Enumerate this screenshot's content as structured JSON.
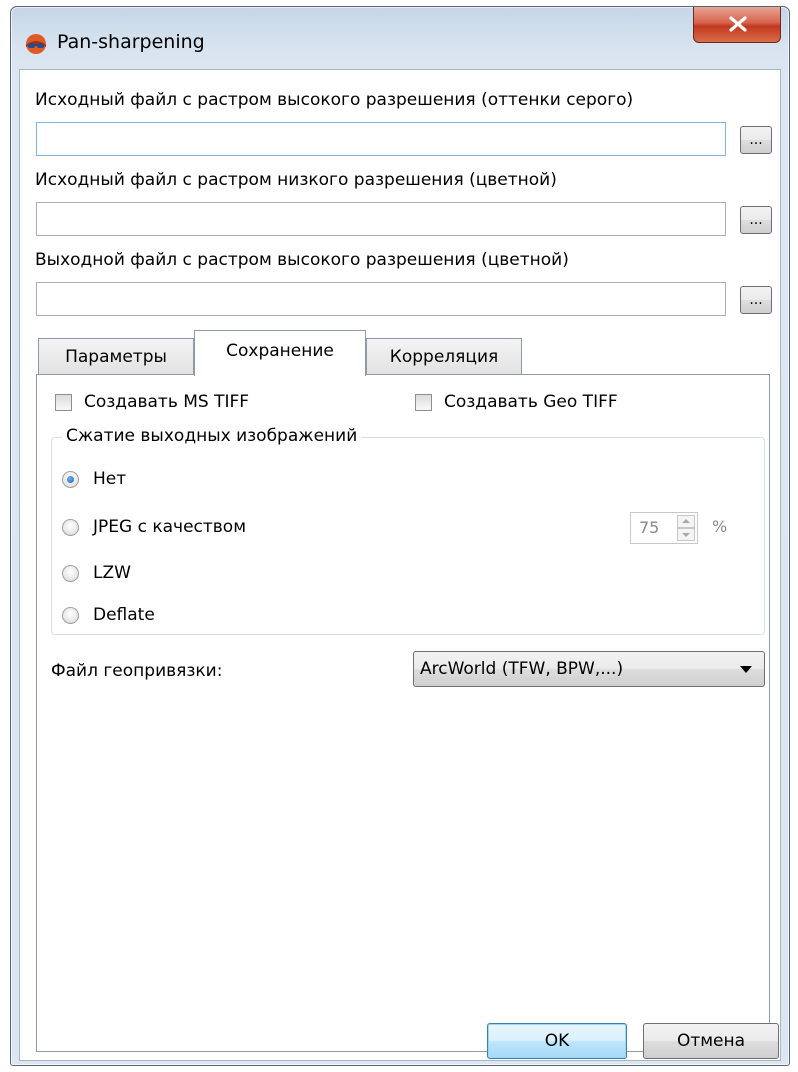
{
  "window": {
    "title": "Pan-sharpening",
    "close_glyph": "✕"
  },
  "fields": {
    "high_res_label": "Исходный файл с растром высокого разрешения (оттенки серого)",
    "high_res_value": "",
    "low_res_label": "Исходный файл с растром низкого разрешения (цветной)",
    "low_res_value": "",
    "output_label": "Выходной файл с растром высокого разрешения (цветной)",
    "output_value": "",
    "browse_label": "..."
  },
  "tabs": {
    "parameters": "Параметры",
    "saving": "Сохранение",
    "correlation": "Корреляция",
    "active": "saving"
  },
  "saving": {
    "create_ms_tiff": "Создавать MS TIFF",
    "create_geo_tiff": "Создавать Geo TIFF",
    "compression_group": "Сжатие выходных изображений",
    "radio_none": "Нет",
    "radio_jpeg": "JPEG с качеством",
    "radio_lzw": "LZW",
    "radio_deflate": "Deflate",
    "selected_compression": "none",
    "jpeg_quality": "75",
    "percent": "%",
    "geo_file_label": "Файл геопривязки:",
    "geo_file_value": "ArcWorld (TFW, BPW,...)"
  },
  "buttons": {
    "ok": "OK",
    "cancel": "Отмена"
  },
  "colors": {
    "title_bar": "#c6d6e7",
    "close_button": "#c2381f",
    "default_button": "#3c7fb1"
  }
}
